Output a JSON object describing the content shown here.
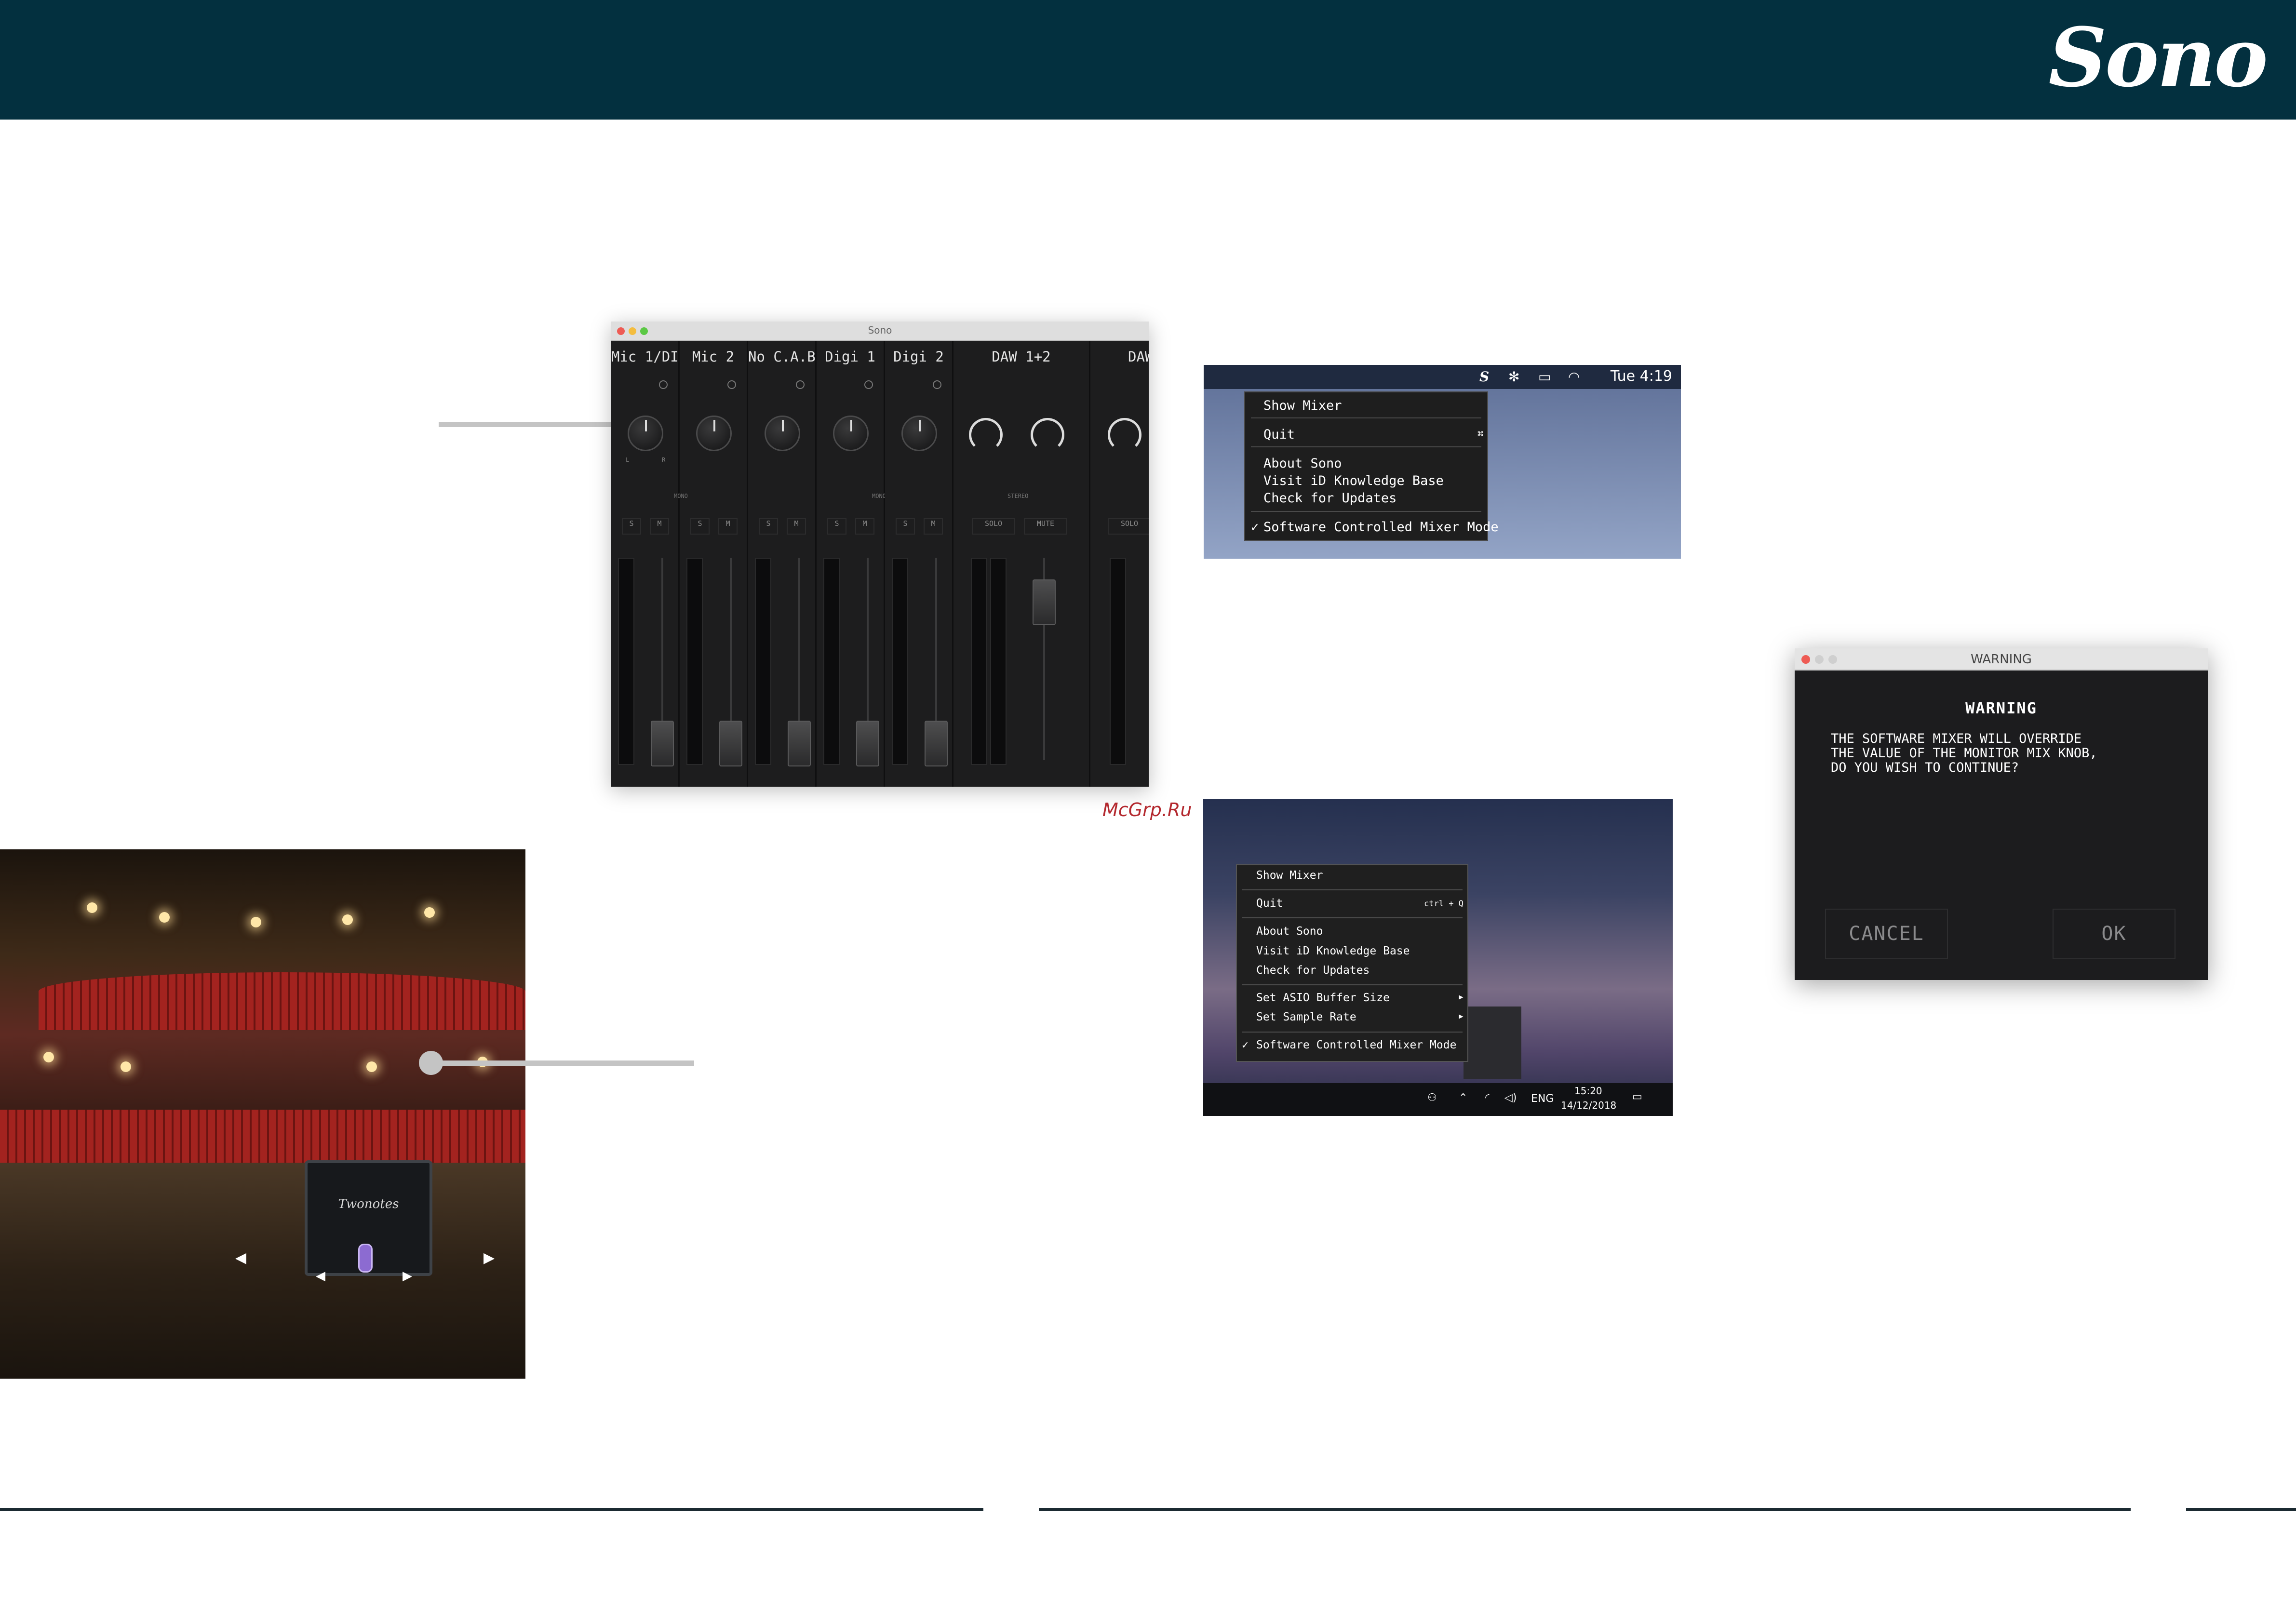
{
  "brand": {
    "logo": "Sono"
  },
  "watermark": "McGrp.Ru",
  "mixer": {
    "title": "Sono",
    "channels": [
      "Mic 1/DI",
      "Mic 2",
      "No C.A.B",
      "Digi 1",
      "Digi 2",
      "DAW 1+2",
      "DAW"
    ],
    "group_labels": [
      "MONO",
      "MONO",
      "STEREO"
    ],
    "solo_label": "S",
    "mute_label": "M",
    "stereo_solo": "SOLO",
    "stereo_mute": "MUTE",
    "knob_l": "L",
    "knob_r": "R"
  },
  "mac_menu": {
    "clock": "Tue 4:19",
    "items": [
      "Show Mixer",
      "Quit",
      "About Sono",
      "Visit iD Knowledge Base",
      "Check for Updates",
      "Software Controlled Mixer Mode"
    ],
    "quit_shortcut": "⌘",
    "checkmark": "✓"
  },
  "win_menu": {
    "items": [
      "Show Mixer",
      "Quit",
      "About Sono",
      "Visit iD Knowledge Base",
      "Check for Updates",
      "Set ASIO Buffer Size",
      "Set Sample Rate",
      "Software Controlled Mixer Mode"
    ],
    "quit_shortcut": "ctrl + Q",
    "checkmark": "✓",
    "submenu_arrow": "▸",
    "taskbar": {
      "lang": "ENG",
      "time": "15:20",
      "date": "14/12/2018"
    }
  },
  "warning_dialog": {
    "window_title": "WARNING",
    "heading": "WARNING",
    "lines": [
      "THE SOFTWARE MIXER WILL OVERRIDE",
      "THE VALUE OF THE MONITOR MIX KNOB,",
      "DO YOU WISH TO CONTINUE?"
    ],
    "cancel_label": "CANCEL",
    "ok_label": "OK"
  },
  "stage_photo": {
    "cab_brand": "Twonotes"
  },
  "colors": {
    "header": "#03303f",
    "callout": "#c4c4c4",
    "rule": "#1b2a31",
    "watermark": "#b3272d"
  }
}
